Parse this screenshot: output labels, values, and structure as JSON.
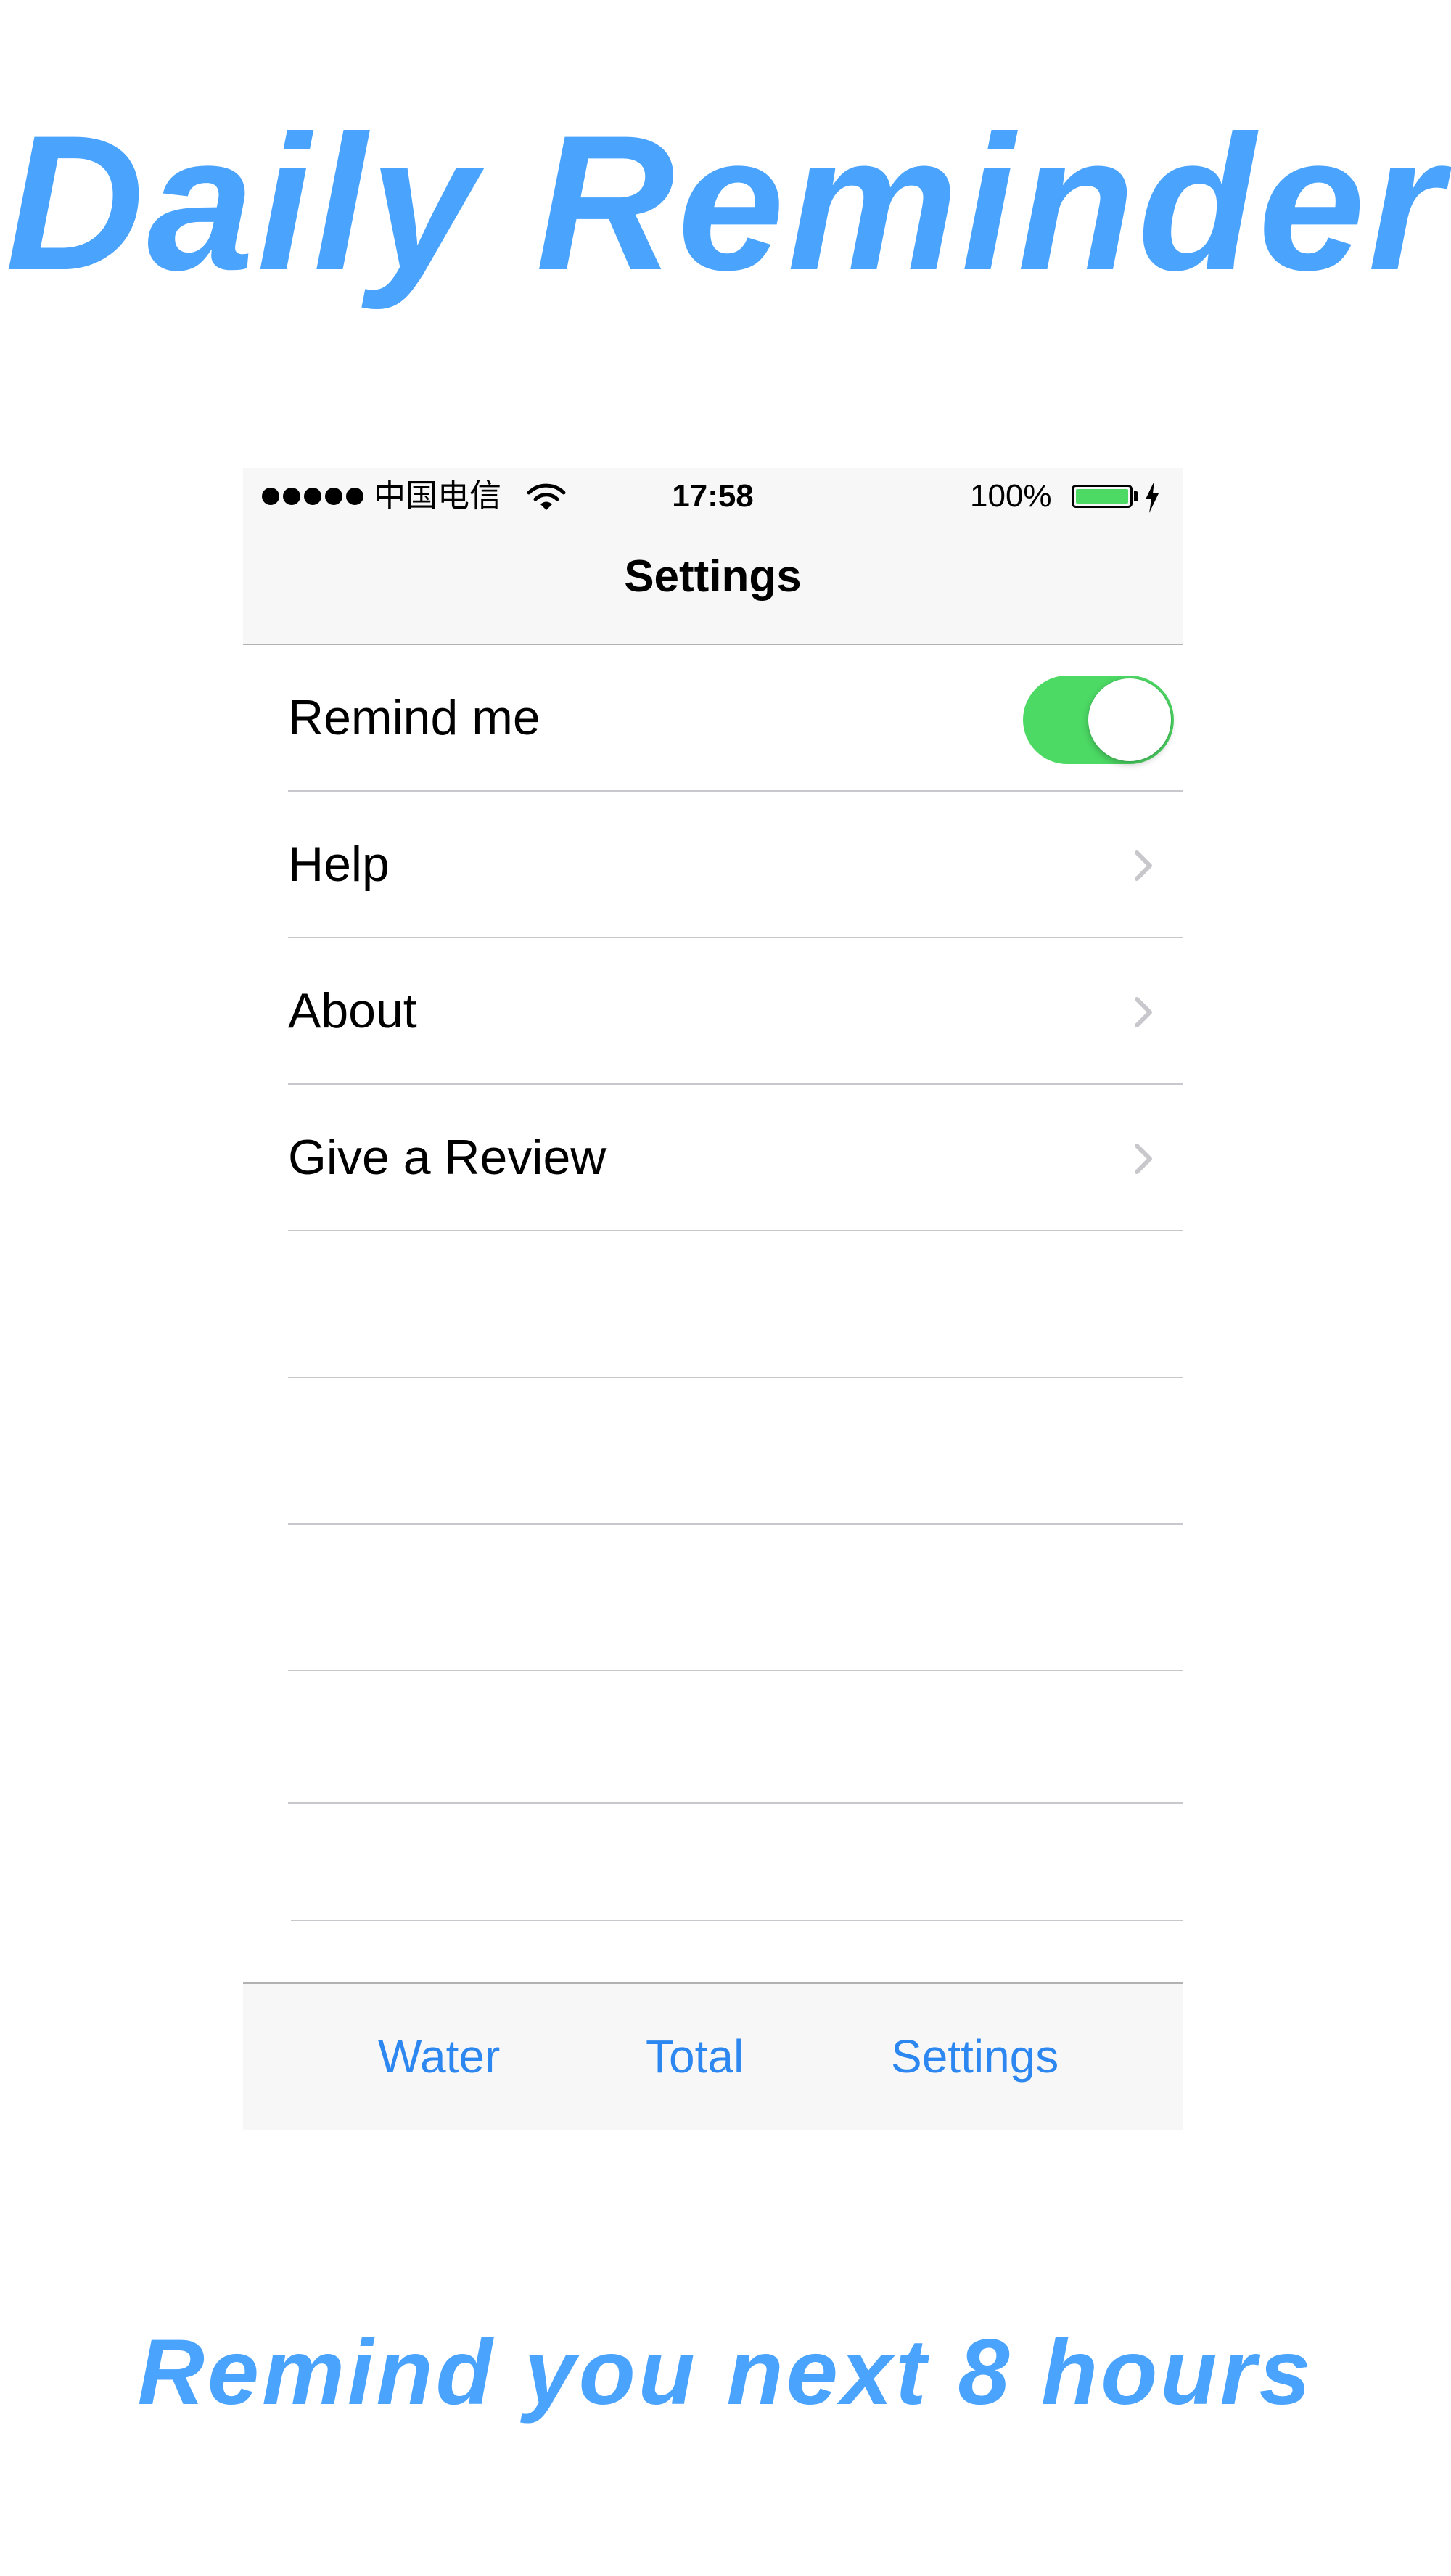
{
  "promo": {
    "title": "Daily Reminder",
    "caption": "Remind you next 8 hours",
    "accent_color": "#4aa3fd"
  },
  "status_bar": {
    "carrier": "中国电信",
    "time": "17:58",
    "battery_percent": "100%",
    "battery_level": 1.0,
    "signal_bars": 5,
    "icons": [
      "signal-dots-icon",
      "wifi-icon",
      "battery-icon",
      "charging-bolt-icon"
    ]
  },
  "nav": {
    "title": "Settings"
  },
  "settings": {
    "remind_me": {
      "label": "Remind me",
      "enabled": true,
      "toggle_color": "#4cd964"
    },
    "rows": [
      {
        "label": "Help",
        "icon": "chevron-right-icon"
      },
      {
        "label": "About",
        "icon": "chevron-right-icon"
      },
      {
        "label": "Give a Review",
        "icon": "chevron-right-icon"
      }
    ]
  },
  "tabbar": {
    "tabs": [
      {
        "label": "Water"
      },
      {
        "label": "Total"
      },
      {
        "label": "Settings"
      }
    ],
    "tint_color": "#2d87f0"
  }
}
